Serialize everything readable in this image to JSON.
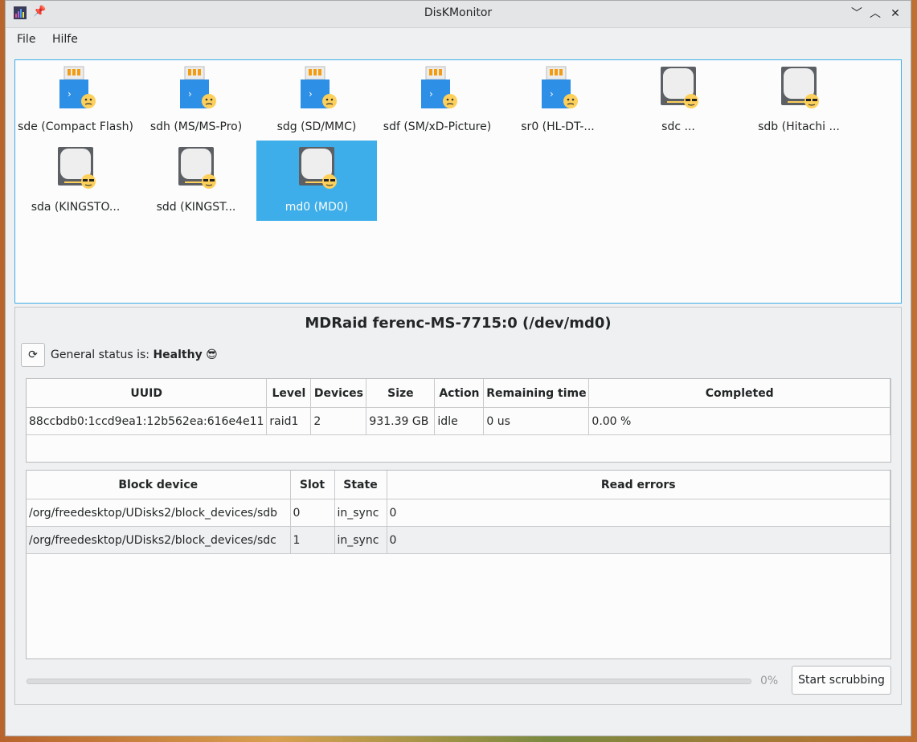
{
  "window": {
    "title": "DisKMonitor"
  },
  "menu": {
    "file": "File",
    "help": "Hilfe"
  },
  "devices": [
    {
      "label": "sde (Compact Flash)",
      "type": "usb",
      "selected": false
    },
    {
      "label": "sdh (MS/MS-Pro)",
      "type": "usb",
      "selected": false
    },
    {
      "label": "sdg (SD/MMC)",
      "type": "usb",
      "selected": false
    },
    {
      "label": "sdf (SM/xD-Picture)",
      "type": "usb",
      "selected": false
    },
    {
      "label": "sr0 (HL-DT-...",
      "type": "usb",
      "selected": false
    },
    {
      "label": "sdc ...",
      "type": "hdd",
      "selected": false
    },
    {
      "label": "sdb (Hitachi ...",
      "type": "hdd",
      "selected": false
    },
    {
      "label": "sda (KINGSTO...",
      "type": "hdd",
      "selected": false
    },
    {
      "label": "sdd (KINGST...",
      "type": "hdd",
      "selected": false
    },
    {
      "label": "md0 (MD0)",
      "type": "hdd",
      "selected": true
    }
  ],
  "detail": {
    "title": "MDRaid ferenc-MS-7715:0 (/dev/md0)",
    "status_prefix": "General status is:",
    "status_value": "Healthy",
    "status_emoji": "😎"
  },
  "raid_table": {
    "headers": [
      "UUID",
      "Level",
      "Devices",
      "Size",
      "Action",
      "Remaining time",
      "Completed"
    ],
    "rows": [
      [
        "88ccbdb0:1ccd9ea1:12b562ea:616e4e11",
        "raid1",
        "2",
        "931.39 GB",
        "idle",
        "0 us",
        "0.00 %"
      ]
    ]
  },
  "block_table": {
    "headers": [
      "Block device",
      "Slot",
      "State",
      "Read errors"
    ],
    "rows": [
      [
        "/org/freedesktop/UDisks2/block_devices/sdb",
        "0",
        "in_sync",
        "0"
      ],
      [
        "/org/freedesktop/UDisks2/block_devices/sdc",
        "1",
        "in_sync",
        "0"
      ]
    ]
  },
  "scrub": {
    "progress": 0,
    "progress_label": "0%",
    "button": "Start scrubbing"
  },
  "colors": {
    "accent": "#3daee9",
    "window_bg": "#eff0f1",
    "view_bg": "#fcfcfc"
  }
}
